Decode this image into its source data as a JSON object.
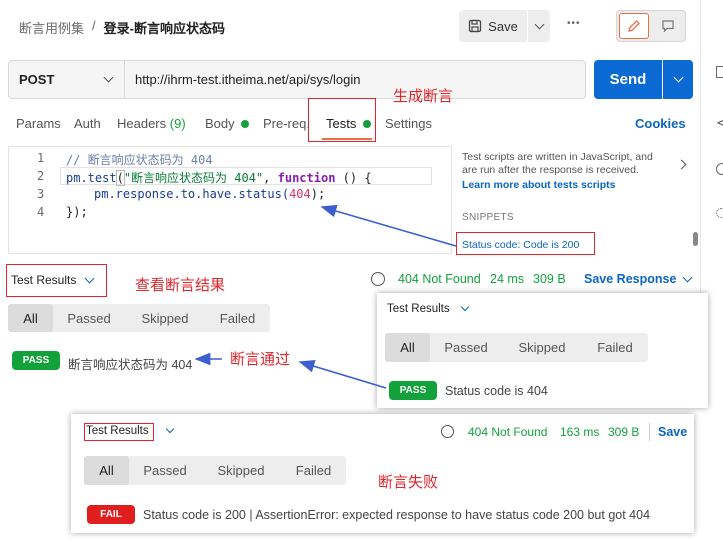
{
  "breadcrumb": {
    "collection": "断言用例集",
    "separator": "/",
    "request": "登录-断言响应状态码"
  },
  "toolbar": {
    "save_label": "Save",
    "more": "•••"
  },
  "request": {
    "method": "POST",
    "url": "http://ihrm-test.itheima.net/api/sys/login",
    "send_label": "Send"
  },
  "tabs": {
    "params": "Params",
    "auth": "Auth",
    "headers": "Headers",
    "headers_count": "(9)",
    "body": "Body",
    "prereq": "Pre-req.",
    "tests": "Tests",
    "settings": "Settings",
    "cookies": "Cookies"
  },
  "editor": {
    "line_numbers": [
      "1",
      "2",
      "3",
      "4"
    ],
    "line1": "// 断言响应状态码为 404",
    "line2_a": "pm.test",
    "line2_b": "(",
    "line2_c": "\"断言响应状态码为 404\"",
    "line2_d": ", ",
    "line2_e": "function",
    "line2_f": " () {",
    "line3_a": "pm.response.to.have.status(",
    "line3_b": "404",
    "line3_c": ");",
    "line4": "});"
  },
  "side_panel": {
    "desc": "Test scripts are written in JavaScript, and are run after the response is received.",
    "learn_more": "Learn more about tests scripts",
    "snippets": "SNIPPETS",
    "snippet1": "Status code: Code is 200"
  },
  "annotations": {
    "generate": "生成断言",
    "view": "查看断言结果",
    "pass": "断言通过",
    "fail": "断言失败"
  },
  "results": {
    "title": "Test Results",
    "status": "404 Not Found",
    "time": "24 ms",
    "size": "309 B",
    "save_response": "Save Response",
    "filters": [
      "All",
      "Passed",
      "Skipped",
      "Failed"
    ],
    "pass_label": "PASS",
    "test_name": "断言响应状态码为 404"
  },
  "popup_pass": {
    "title": "Test Results",
    "filters": [
      "All",
      "Passed",
      "Skipped",
      "Failed"
    ],
    "pass_label": "PASS",
    "message": "Status code is 404"
  },
  "popup_fail": {
    "title": "Test Results",
    "status": "404 Not Found",
    "time": "163 ms",
    "size": "309 B",
    "save": "Save",
    "filters": [
      "All",
      "Passed",
      "Skipped",
      "Failed"
    ],
    "fail_label": "FAIL",
    "message": "Status code is 200 | AssertionError: expected response to have status code 200 but got 404"
  },
  "colors": {
    "send_blue": "#0b69d4",
    "link_blue": "#0a66c2",
    "pass_green": "#13a13c",
    "fail_red": "#e01e1e",
    "annot_red": "#e0262b",
    "arrow_blue": "#3b5fcf"
  }
}
